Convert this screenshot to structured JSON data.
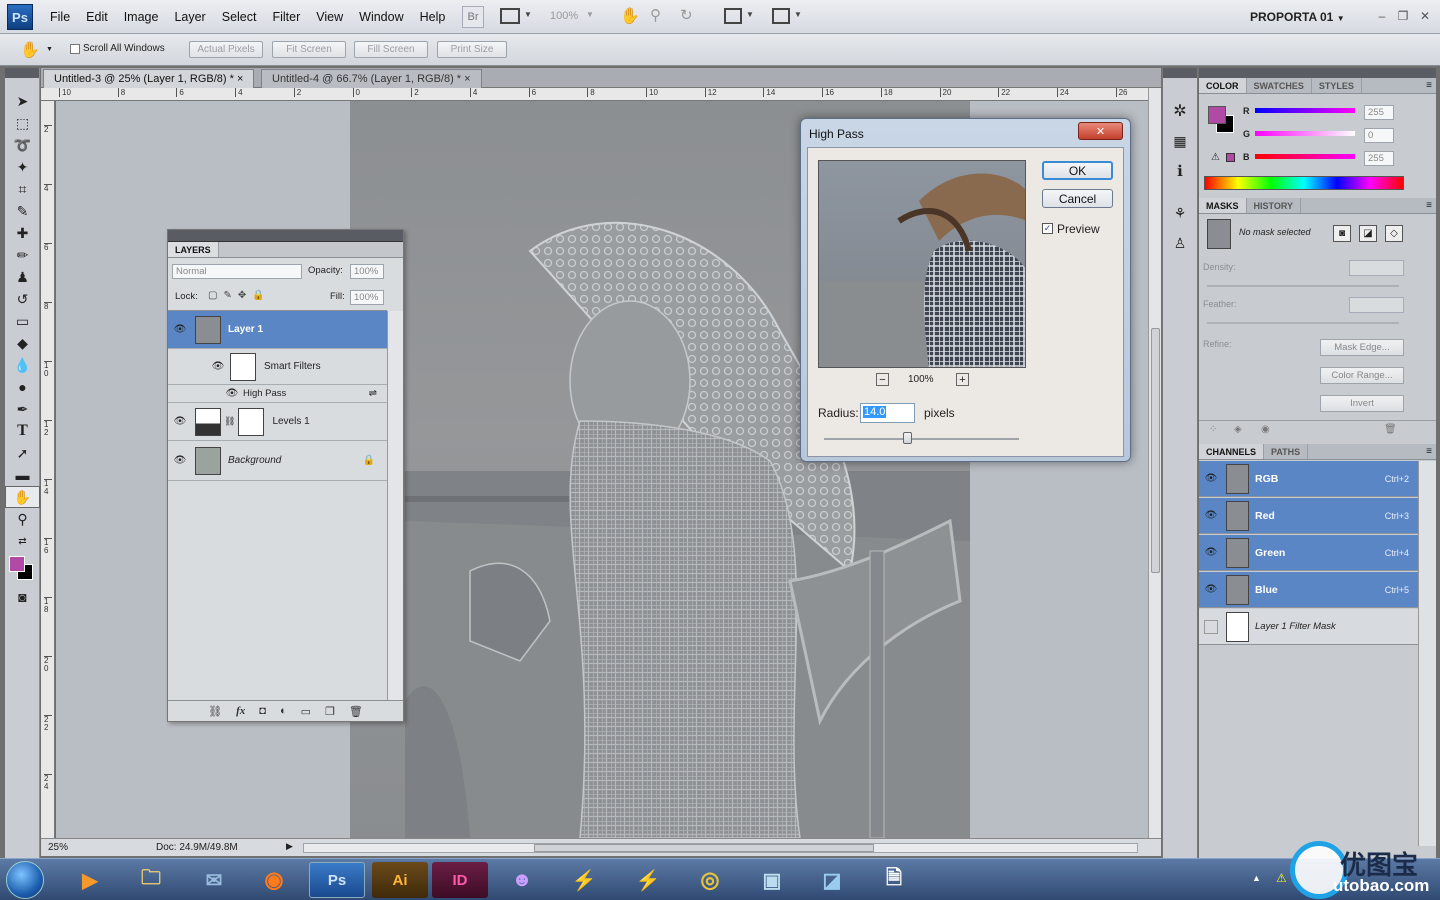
{
  "app": {
    "logo": "Ps"
  },
  "menu": [
    "File",
    "Edit",
    "Image",
    "Layer",
    "Select",
    "Filter",
    "View",
    "Window",
    "Help"
  ],
  "appbar": {
    "bridge": "Br",
    "zoom": "100%",
    "workspace": "PROPORTA 01"
  },
  "options": {
    "scroll_all": "Scroll All Windows",
    "buttons": [
      "Actual Pixels",
      "Fit Screen",
      "Fill Screen",
      "Print Size"
    ]
  },
  "doc_tabs": [
    {
      "label": "Untitled-3 @ 25% (Layer 1, RGB/8) *",
      "close": "×"
    },
    {
      "label": "Untitled-4 @ 66.7% (Layer 1, RGB/8) *",
      "close": "×"
    }
  ],
  "ruler_h": [
    "10",
    "8",
    "6",
    "4",
    "2",
    "0",
    "2",
    "4",
    "6",
    "8",
    "10",
    "12",
    "14",
    "16",
    "18",
    "20",
    "22",
    "24",
    "26"
  ],
  "ruler_v": [
    "2",
    "4",
    "6",
    "8",
    "10",
    "12",
    "14",
    "16",
    "18",
    "20",
    "22",
    "24"
  ],
  "status": {
    "zoom": "25%",
    "doc": "Doc: 24.9M/49.8M"
  },
  "layers_panel": {
    "tab": "LAYERS",
    "blend": "Normal",
    "opacity_label": "Opacity:",
    "opacity": "100%",
    "lock_label": "Lock:",
    "fill_label": "Fill:",
    "fill": "100%",
    "layers": [
      {
        "name": "Layer 1"
      },
      {
        "name": "Smart Filters"
      },
      {
        "name": "High Pass"
      },
      {
        "name": "Levels 1"
      },
      {
        "name": "Background"
      }
    ]
  },
  "color_panel": {
    "tabs": [
      "COLOR",
      "SWATCHES",
      "STYLES"
    ],
    "r_label": "R",
    "g_label": "G",
    "b_label": "B",
    "r": "255",
    "g": "0",
    "b": "255",
    "foreground": "#b04aa4"
  },
  "masks_panel": {
    "tabs": [
      "MASKS",
      "HISTORY"
    ],
    "no_mask": "No mask selected",
    "density": "Density:",
    "feather": "Feather:",
    "refine": "Refine:",
    "buttons": [
      "Mask Edge...",
      "Color Range...",
      "Invert"
    ]
  },
  "channels_panel": {
    "tabs": [
      "CHANNELS",
      "PATHS"
    ],
    "channels": [
      {
        "name": "RGB",
        "key": "Ctrl+2"
      },
      {
        "name": "Red",
        "key": "Ctrl+3"
      },
      {
        "name": "Green",
        "key": "Ctrl+4"
      },
      {
        "name": "Blue",
        "key": "Ctrl+5"
      },
      {
        "name": "Layer 1 Filter Mask",
        "key": ""
      }
    ]
  },
  "dialog": {
    "title": "High Pass",
    "ok": "OK",
    "cancel": "Cancel",
    "preview": "Preview",
    "zoom": "100%",
    "minus": "−",
    "plus": "+",
    "radius_label": "Radius:",
    "radius": "14.0",
    "unit": "pixels"
  },
  "taskbar": {
    "items": [
      "Ps",
      "Ai",
      "ID"
    ],
    "watermark_cn": "优图宝",
    "watermark": "utobao.com"
  }
}
